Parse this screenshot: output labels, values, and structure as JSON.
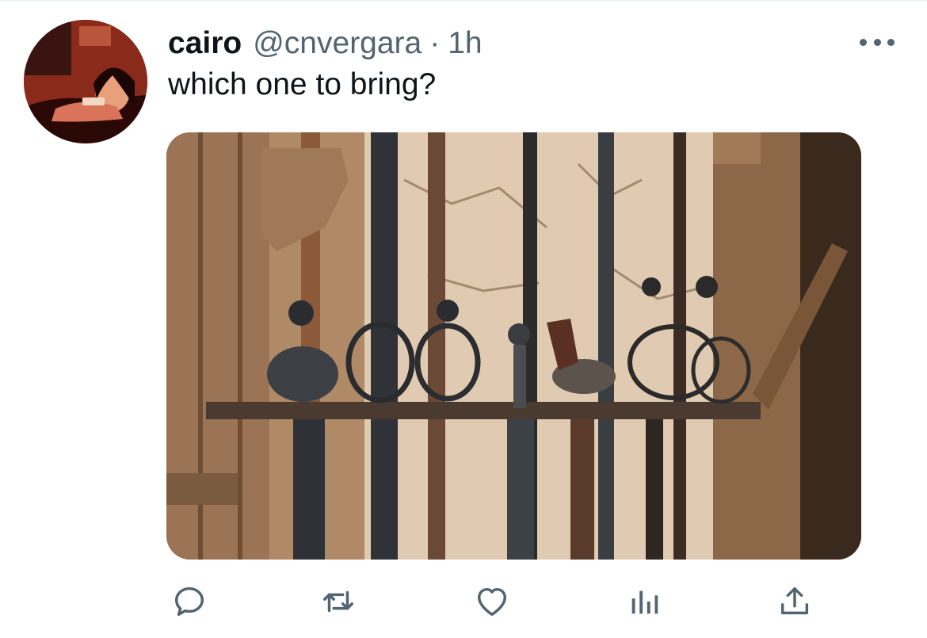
{
  "tweet": {
    "display_name": "cairo",
    "handle": "@cnvergara",
    "separator": "·",
    "timestamp": "1h",
    "text": "which one to bring?",
    "media": {
      "description_icon": "photo-swords-on-rack"
    }
  },
  "actions": [
    {
      "icon": "reply-icon"
    },
    {
      "icon": "retweet-icon"
    },
    {
      "icon": "like-icon"
    },
    {
      "icon": "analytics-icon"
    },
    {
      "icon": "share-icon"
    }
  ],
  "colors": {
    "text_primary": "#0f1419",
    "text_secondary": "#536471",
    "background": "#ffffff"
  }
}
